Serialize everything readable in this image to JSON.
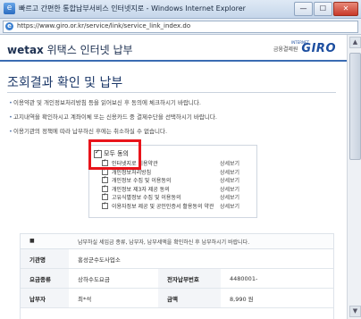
{
  "window": {
    "title": "빠르고 간편한 통합납부서비스 인터넷지로 - Windows Internet Explorer",
    "url": "https://www.giro.or.kr/service/link/service_link_index.do"
  },
  "header": {
    "brand_prefix": "wetax",
    "brand_suffix": "위택스 인터넷 납부",
    "logo_small": "금융결제원",
    "logo_mark": "GIRO",
    "logo_sup": "INTERNET"
  },
  "page_title": "조회결과 확인 및 납부",
  "notices": [
    "이용약관 및 개인정보처리방침 등을 읽어보신 후 동의에 체크하시기 바랍니다.",
    "고지내역을 확인하시고 계좌이체 또는 신용카드 중 결제수단을 선택하시기 바랍니다.",
    "이용기관의 정책에 따라 납부하신 후에는 취소하실 수 없습니다."
  ],
  "agreement": {
    "all_label": "모두 동의",
    "items": [
      {
        "label": "인터넷지로 이용약관",
        "detail": "상세보기"
      },
      {
        "label": "개인정보처리방침",
        "detail": "상세보기"
      },
      {
        "label": "개인정보 수집 및 이용동의",
        "detail": "상세보기"
      },
      {
        "label": "개인정보 제3자 제공 동의",
        "detail": "상세보기"
      },
      {
        "label": "고유식별정보 수집 및 이용동의",
        "detail": "상세보기"
      },
      {
        "label": "이용자정보 제공 및 공인인증서 활용동의 약관",
        "detail": "상세보기"
      }
    ]
  },
  "info": {
    "head_text": "납부하실 세입금 종류, 납부자, 납부세액을 확인하신 후 납부하시기 바랍니다.",
    "rows": [
      {
        "k1": "기관명",
        "v1": "홍성군수도사업소",
        "k2": "",
        "v2": ""
      },
      {
        "k1": "요금종류",
        "v1": "상하수도요금",
        "k2": "전자납부번호",
        "v2": "4480001-"
      },
      {
        "k1": "납부자",
        "v1": "최*석",
        "k2": "금액",
        "v2": "8,990 원"
      }
    ]
  },
  "colors": {
    "accent": "#3a6cb3",
    "highlight": "#e8141b",
    "brand": "#1e3152"
  }
}
